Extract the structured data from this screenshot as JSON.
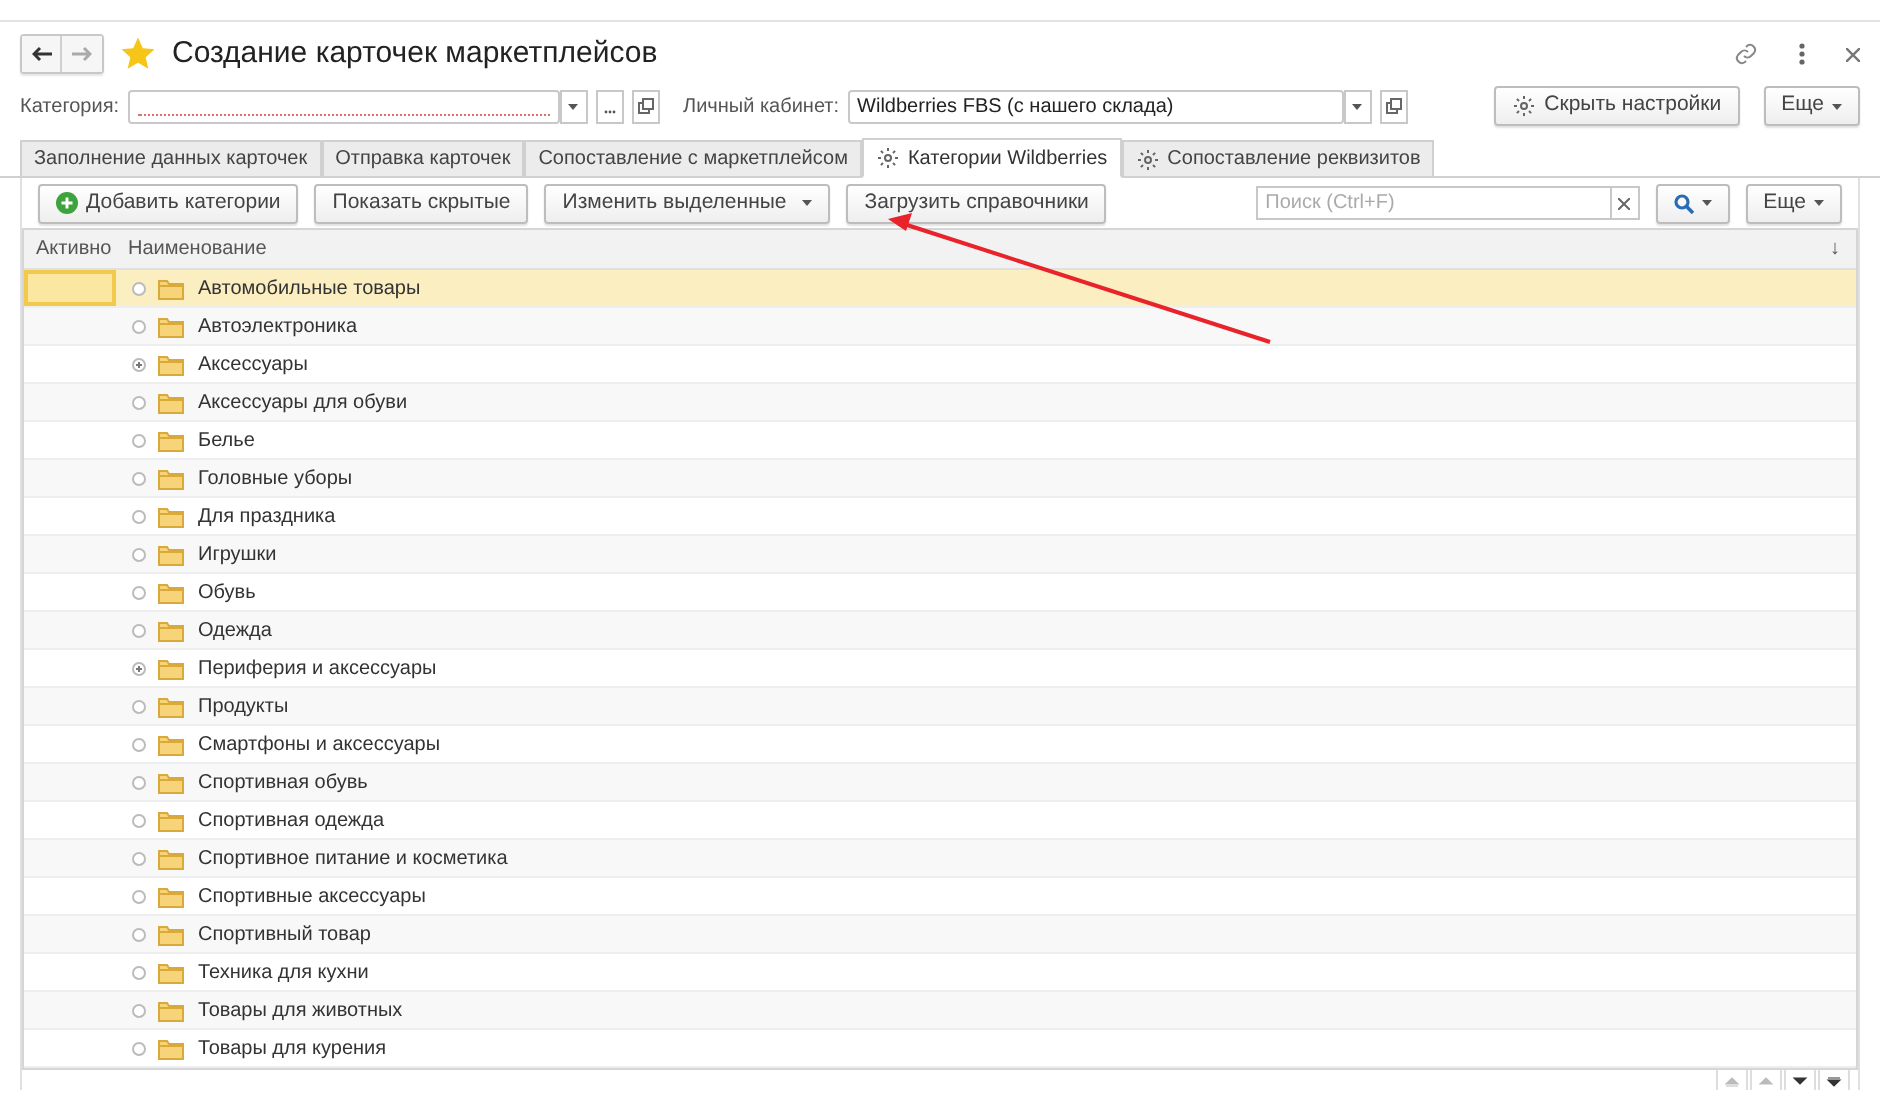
{
  "window": {
    "title": "Создание карточек маркетплейсов"
  },
  "filters": {
    "category_label": "Категория:",
    "cabinet_label": "Личный кабинет:",
    "cabinet_value": "Wildberries FBS (с нашего склада)",
    "hide_settings": "Скрыть настройки",
    "more": "Еще"
  },
  "tabs": [
    {
      "label": "Заполнение данных карточек",
      "selected": false,
      "icon": false
    },
    {
      "label": "Отправка карточек",
      "selected": false,
      "icon": false
    },
    {
      "label": "Сопоставление с маркетплейсом",
      "selected": false,
      "icon": false
    },
    {
      "label": "Категории Wildberries",
      "selected": true,
      "icon": true
    },
    {
      "label": "Сопоставление реквизитов",
      "selected": false,
      "icon": true
    }
  ],
  "toolbar": {
    "add": "Добавить категории",
    "show_hidden": "Показать скрытые",
    "change_selected": "Изменить выделенные",
    "load": "Загрузить справочники",
    "search_placeholder": "Поиск (Ctrl+F)",
    "more": "Еще"
  },
  "table": {
    "columns": [
      "Активно",
      "Наименование"
    ],
    "sort_mark": "↓",
    "rows": [
      {
        "name": "Автомобильные товары",
        "expandable": false,
        "selected": true
      },
      {
        "name": "Автоэлектроника",
        "expandable": false,
        "selected": false
      },
      {
        "name": "Аксессуары",
        "expandable": true,
        "selected": false
      },
      {
        "name": "Аксессуары для обуви",
        "expandable": false,
        "selected": false
      },
      {
        "name": "Белье",
        "expandable": false,
        "selected": false
      },
      {
        "name": "Головные уборы",
        "expandable": false,
        "selected": false
      },
      {
        "name": "Для праздника",
        "expandable": false,
        "selected": false
      },
      {
        "name": "Игрушки",
        "expandable": false,
        "selected": false
      },
      {
        "name": "Обувь",
        "expandable": false,
        "selected": false
      },
      {
        "name": "Одежда",
        "expandable": false,
        "selected": false
      },
      {
        "name": "Периферия и аксессуары",
        "expandable": true,
        "selected": false
      },
      {
        "name": "Продукты",
        "expandable": false,
        "selected": false
      },
      {
        "name": "Смартфоны и аксессуары",
        "expandable": false,
        "selected": false
      },
      {
        "name": "Спортивная обувь",
        "expandable": false,
        "selected": false
      },
      {
        "name": "Спортивная одежда",
        "expandable": false,
        "selected": false
      },
      {
        "name": "Спортивное питание и косметика",
        "expandable": false,
        "selected": false
      },
      {
        "name": "Спортивные аксессуары",
        "expandable": false,
        "selected": false
      },
      {
        "name": "Спортивный товар",
        "expandable": false,
        "selected": false
      },
      {
        "name": "Техника для кухни",
        "expandable": false,
        "selected": false
      },
      {
        "name": "Товары для животных",
        "expandable": false,
        "selected": false
      },
      {
        "name": "Товары для курения",
        "expandable": false,
        "selected": false
      }
    ]
  }
}
